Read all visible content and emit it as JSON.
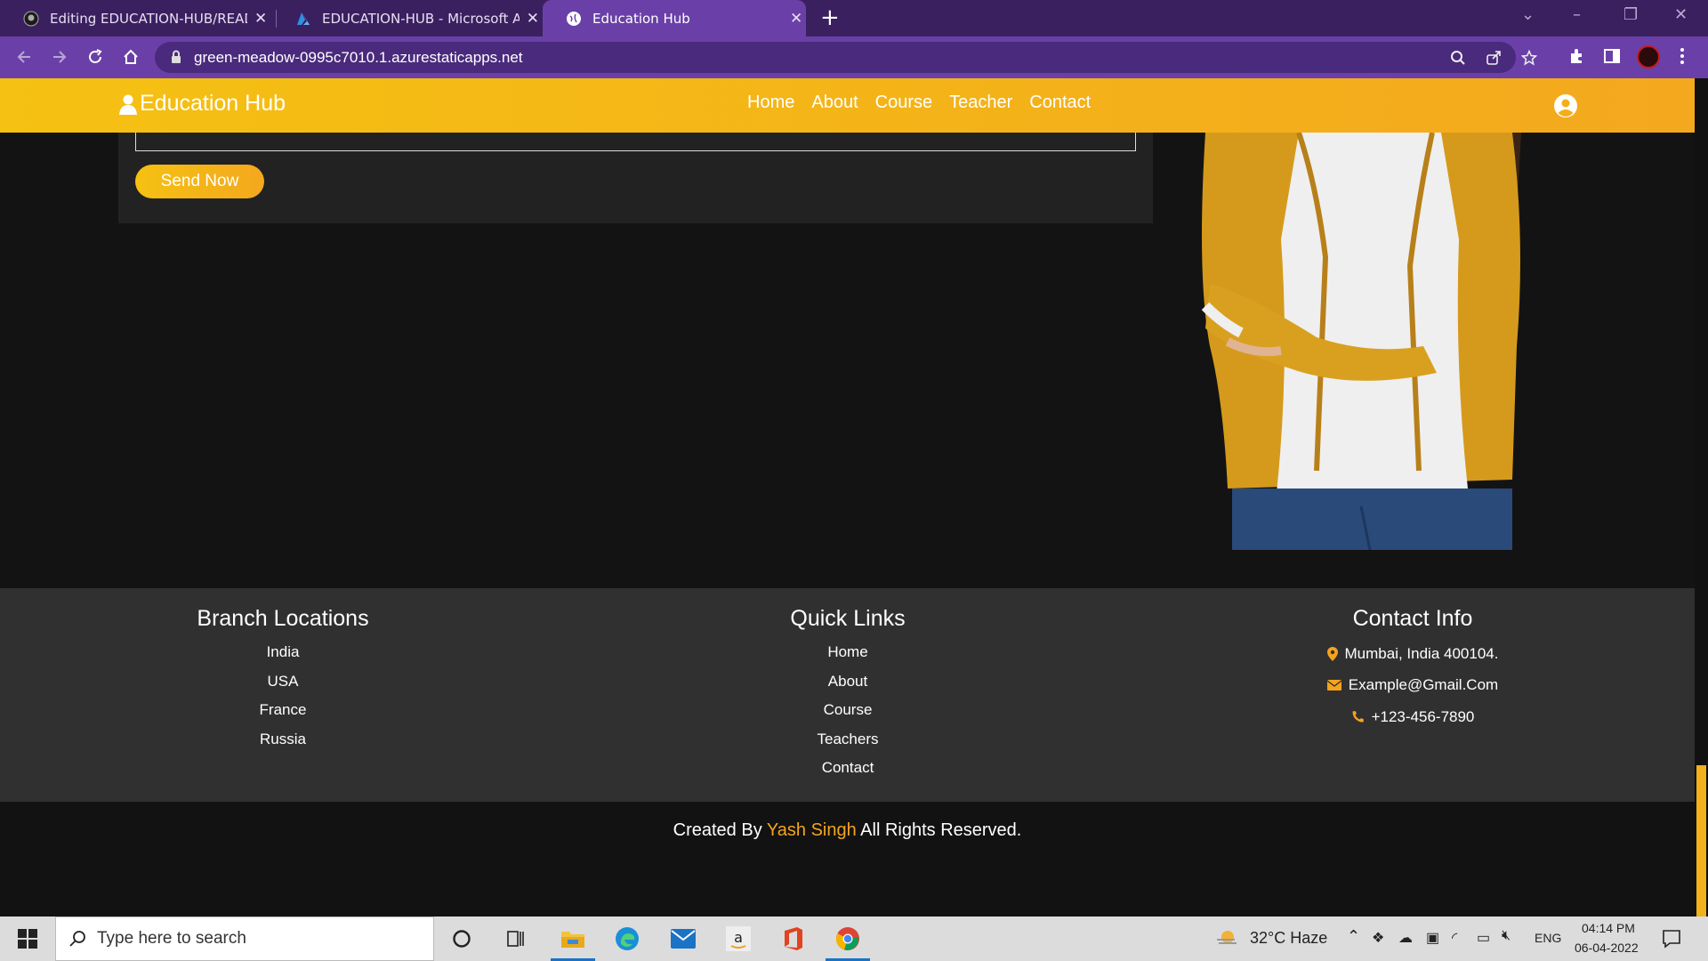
{
  "browser": {
    "tabs": [
      {
        "title": "Editing EDUCATION-HUB/README",
        "icon": "github-icon"
      },
      {
        "title": "EDUCATION-HUB - Microsoft Azure",
        "icon": "azure-icon"
      },
      {
        "title": "Education Hub",
        "icon": "globe-icon",
        "active": true
      }
    ],
    "url": "green-meadow-0995c7010.1.azurestaticapps.net"
  },
  "site": {
    "logo": "Education Hub",
    "nav": [
      "Home",
      "About",
      "Course",
      "Teacher",
      "Contact"
    ],
    "accent": "#f5b617"
  },
  "form": {
    "send_label": "Send Now"
  },
  "footer": {
    "branches": {
      "title": "Branch Locations",
      "items": [
        "India",
        "USA",
        "France",
        "Russia"
      ]
    },
    "quick_links": {
      "title": "Quick Links",
      "items": [
        "Home",
        "About",
        "Course",
        "Teachers",
        "Contact"
      ]
    },
    "contact": {
      "title": "Contact Info",
      "address": "Mumbai, India 400104.",
      "email": "Example@Gmail.Com",
      "phone": "+123-456-7890"
    }
  },
  "credit": {
    "prefix": "Created By",
    "name": "Yash Singh",
    "suffix": "All Rights Reserved."
  },
  "taskbar": {
    "search_placeholder": "Type here to search",
    "weather": "32°C  Haze",
    "lang": "ENG",
    "time": "04:14 PM",
    "date": "06-04-2022"
  }
}
